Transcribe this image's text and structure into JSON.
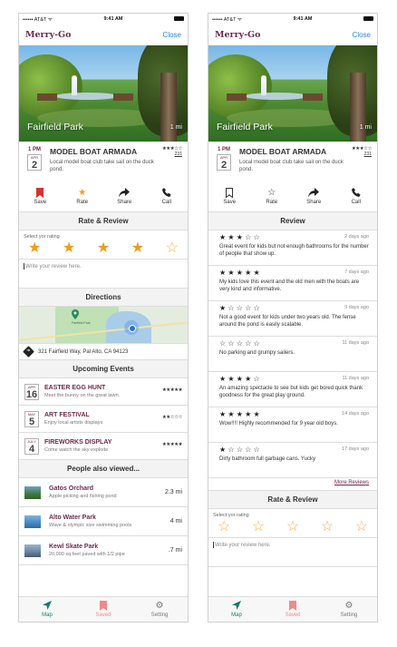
{
  "status_bar": {
    "carrier": "•••••• AT&T ᯤ",
    "time": "9:41 AM"
  },
  "app": {
    "title": "Merry-Go",
    "close_label": "Close"
  },
  "hero": {
    "title": "Fairfield Park",
    "distance": "1 mi"
  },
  "event": {
    "time": "1 PM",
    "month": "APR",
    "day": "2",
    "title": "MODEL BOAT ARMADA",
    "description": "Local model boat club take sail on the duck pond.",
    "rating_stars": "★★★☆☆",
    "rating_count": "231"
  },
  "actions": {
    "save_label": "Save",
    "rate_label": "Rate",
    "share_label": "Share",
    "call_label": "Call"
  },
  "left": {
    "rate_header": "Rate & Review",
    "rate_hint": "Select yor rating",
    "selected_rating": 4,
    "review_placeholder": "Write your review here.",
    "directions_header": "Directions",
    "map_label": "Fairfield Park",
    "address": "321 Fairfield Way, Pal Alto, CA  94123",
    "upcoming_header": "Upcoming Events",
    "upcoming": [
      {
        "month": "APR",
        "day": "16",
        "title": "EASTER EGG HUNT",
        "desc": "Meet the bunny on the great lawn.",
        "stars": "★★★★★"
      },
      {
        "month": "MAY",
        "day": "5",
        "title": "ART FESTIVAL",
        "desc": "Enjoy local artists displays",
        "stars": "★★☆☆☆"
      },
      {
        "month": "JULY",
        "day": "4",
        "title": "FIREWORKS DISPLAY",
        "desc": "Come watch the sky explode",
        "stars": "★★★★★"
      }
    ],
    "people_header": "People also viewed...",
    "places": [
      {
        "name": "Gatos Orchard",
        "desc": "Apple picking and fishing pond",
        "distance": "2.3 mi"
      },
      {
        "name": "Alto Water Park",
        "desc": "Wave & olympic size swimming pools",
        "distance": "4 mi"
      },
      {
        "name": "Kewl Skate Park",
        "desc": "20,000 sq feet paved with 1/2 pipe",
        "distance": ".7 mi"
      }
    ]
  },
  "right": {
    "review_header": "Review",
    "reviews": [
      {
        "stars": "★★★☆☆",
        "date": "2 days ago",
        "text": "Great event for kids but not enough bathrooms for the number of people that show up."
      },
      {
        "stars": "★★★★★",
        "date": "7 days ago",
        "text": "My kids love this event and the old men with the boats are very kind and informative."
      },
      {
        "stars": "★☆☆☆☆",
        "date": "9 days ago",
        "text": "Not a good event for kids under two years old. The fense around the pond is easily scalable."
      },
      {
        "stars": "☆☆☆☆☆",
        "date": "11 days ago",
        "text": "No parking and grumpy sailers."
      },
      {
        "stars": "★★★★☆",
        "date": "11 days ago",
        "text": "An amazing spectacle to see but kids get bored quick thank goodness for the great play ground."
      },
      {
        "stars": "★★★★★",
        "date": "14 days ago",
        "text": "Wow!!!! Highly recommended for 9 year old boys."
      },
      {
        "stars": "★☆☆☆☆",
        "date": "17 days ago",
        "text": "Dirty bathroom full garbage cans. Yucky"
      }
    ],
    "more_reviews": "More Reviews",
    "rate_header": "Rate & Review",
    "rate_hint": "Select yor rating",
    "selected_rating": 0,
    "review_placeholder": "Write your review here."
  },
  "tabs": {
    "map_label": "Map",
    "saved_label": "Saved",
    "setting_label": "Setting"
  },
  "colors": {
    "brand": "#6b2b4a",
    "accent_blue": "#2a86d6",
    "star_orange": "#f19a1b",
    "save_red": "#d9302f",
    "map_teal": "#137a6a"
  }
}
